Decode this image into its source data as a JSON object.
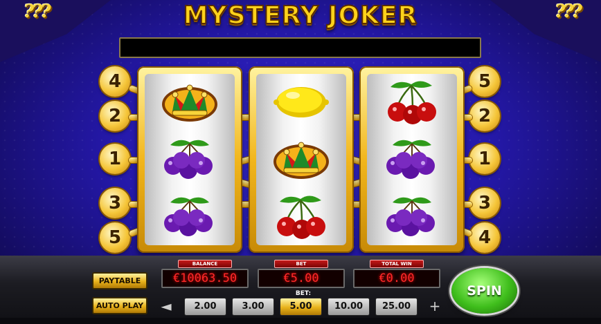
{
  "game": {
    "title": "MYSTERY JOKER",
    "corner_marks": "???"
  },
  "message_bar": "",
  "paylines": {
    "left": [
      "4",
      "2",
      "1",
      "3",
      "5"
    ],
    "right": [
      "5",
      "2",
      "1",
      "3",
      "4"
    ]
  },
  "reels": [
    {
      "symbols": [
        "joker-hat",
        "plums",
        "plums"
      ]
    },
    {
      "symbols": [
        "lemon",
        "joker-hat",
        "cherries"
      ]
    },
    {
      "symbols": [
        "cherries",
        "plums",
        "plums"
      ]
    }
  ],
  "displays": {
    "balance": {
      "label": "BALANCE",
      "value": "€10063.50"
    },
    "bet": {
      "label": "BET",
      "value": "€5.00"
    },
    "total_win": {
      "label": "TOTAL WIN",
      "value": "€0.00"
    }
  },
  "buttons": {
    "paytable": "PAYTABLE",
    "autoplay": "AUTO PLAY",
    "spin": "SPIN",
    "prev": "◄",
    "next": "+"
  },
  "bet_selector": {
    "label": "BET:",
    "options": [
      "2.00",
      "3.00",
      "5.00",
      "10.00",
      "25.00"
    ],
    "selected": "5.00"
  },
  "colors": {
    "accent_gold": "#f5c63a",
    "background_blue": "#2418a8",
    "spin_green": "#3fbe1c",
    "display_red": "#ff2a2a"
  }
}
